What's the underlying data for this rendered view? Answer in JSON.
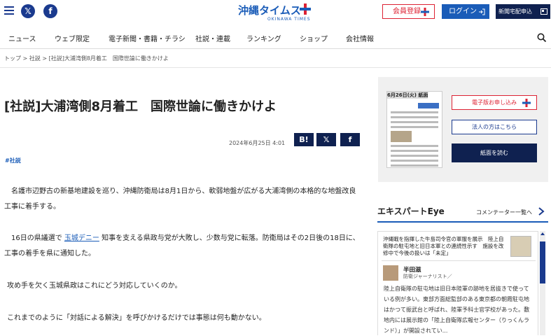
{
  "header": {
    "logo_text": "沖縄タイムス",
    "logo_sub": "OKINAWA TIMES",
    "logo_plus": "プラス",
    "member_label": "会員登録",
    "login_label": "ログイン",
    "paper_label": "新聞宅配申込"
  },
  "nav": {
    "items": [
      "ニュース",
      "ウェブ限定",
      "電子新聞・書籍・チラシ",
      "社説・連載",
      "ランキング",
      "ショップ",
      "会社情報"
    ]
  },
  "breadcrumb": "トップ > 社説 > [社説]大浦湾側8月着工　国際世論に働きかけよ",
  "article": {
    "title": "[社説]大浦湾側8月着工　国際世論に働きかけよ",
    "date": "2024年6月25日 4:01",
    "share": {
      "hatena": "B!",
      "x": "𝕏",
      "facebook": "f"
    },
    "tag": "#社説",
    "paragraphs": [
      {
        "text": "名護市辺野古の新基地建設を巡り、沖縄防衛局は8月1日から、軟弱地盤が広がる大浦湾側の本格的な地盤改良工事に着手する。"
      },
      {
        "pre": "16日の県議選で ",
        "link": "玉城デニー",
        "post": " 知事を支える県政与党が大敗し、少数与党に転落。防衛局はその2日後の18日に、工事の着手を県に通知した。"
      },
      {
        "text": "攻め手を欠く玉城県政はこれにどう対応していくのか。"
      },
      {
        "text": "これまでのように「対話による解決」を呼びかけるだけでは事態は何も動かない。"
      }
    ]
  },
  "sidebar": {
    "paper_date": "6月26日(火) 紙面",
    "btn_subscribe": "電子版お申し込み",
    "btn_corporate": "法人の方はこちら",
    "btn_read": "紙面を読む",
    "expert_title": "エキスパートEye",
    "expert_link": "コメンテーター一覧へ",
    "card": {
      "headline": "沖縄戦を指揮した牛島司令官の軍服を展示　陸上自衛隊の駐屯地と旧日本軍との連続性示す　施設を改修中で今後の扱いは「未定」",
      "author": "半田滋",
      "role": "防衛ジャーナリスト／",
      "body": "陸上自衛隊の駐屯地は旧日本陸軍の跡地を居抜きで使っている例が多い。東部方面総監部のある東京都の朝霞駐屯地はかつて振武台と呼ばれ、陸軍予科士官学校があった。敷地内には展示館の「陸上自衛隊広報センター（りっくんランド）」が開設されてい..."
    }
  }
}
